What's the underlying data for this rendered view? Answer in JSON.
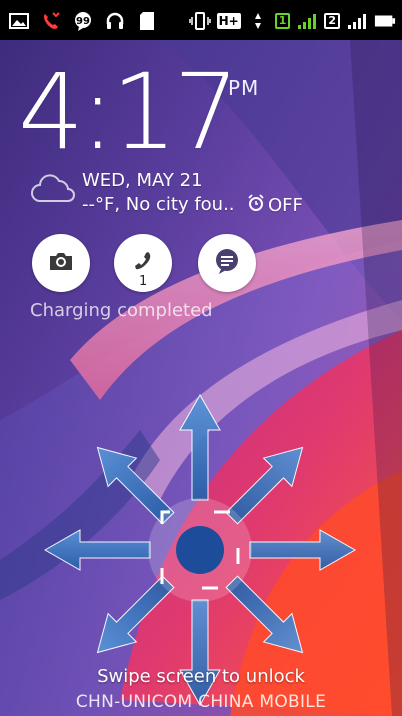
{
  "status_bar": {
    "left_icons": [
      "image-notification-icon",
      "missed-call-icon",
      "chat-icon",
      "headset-icon",
      "sd-card-icon"
    ],
    "right_icons": [
      "vibrate-icon",
      "network-type-icon",
      "sim1-icon",
      "signal-icon",
      "sim2-icon",
      "signal-icon",
      "battery-icon"
    ],
    "network_type": "H+",
    "sim1_label": "1",
    "sim2_label": "2"
  },
  "clock": {
    "time": "4:17",
    "ampm": "PM"
  },
  "weather": {
    "date": "WED, MAY 21",
    "summary": "--°F, No city fou..",
    "icon": "cloud-icon"
  },
  "alarm": {
    "label": "OFF",
    "icon": "alarm-clock-icon"
  },
  "quick_actions": [
    {
      "name": "camera",
      "icon": "camera-icon"
    },
    {
      "name": "phone",
      "icon": "phone-icon",
      "badge": "1"
    },
    {
      "name": "messages",
      "icon": "message-icon"
    }
  ],
  "charging_text": "Charging completed",
  "swipe_hint": "Swipe screen to unlock",
  "carrier": "CHN-UNICOM  CHINA  MOBILE",
  "colors": {
    "arrow": "#2f6fb8",
    "unlock_center": "#1d4c9a",
    "sim_green": "#6ad12a"
  }
}
